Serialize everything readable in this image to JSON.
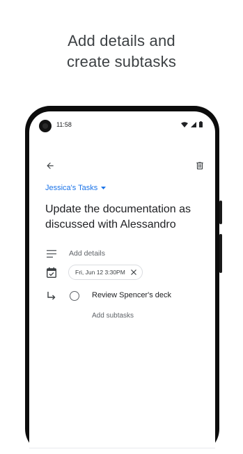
{
  "promo": {
    "title": "Add details and\ncreate subtasks"
  },
  "status_bar": {
    "time": "11:58"
  },
  "app_bar": {
    "back_icon": "arrow-back-icon",
    "delete_icon": "trash-icon"
  },
  "task": {
    "list_name": "Jessica's Tasks",
    "title": "Update the documentation as discussed with Alessandro",
    "details_placeholder": "Add details",
    "date_chip": "Fri, Jun 12  3:30PM",
    "subtasks": [
      {
        "title": "Review Spencer's deck",
        "completed": false
      }
    ],
    "add_subtasks_label": "Add subtasks"
  },
  "colors": {
    "accent": "#1a73e8",
    "text": "#202124",
    "secondary": "#5f6368"
  }
}
